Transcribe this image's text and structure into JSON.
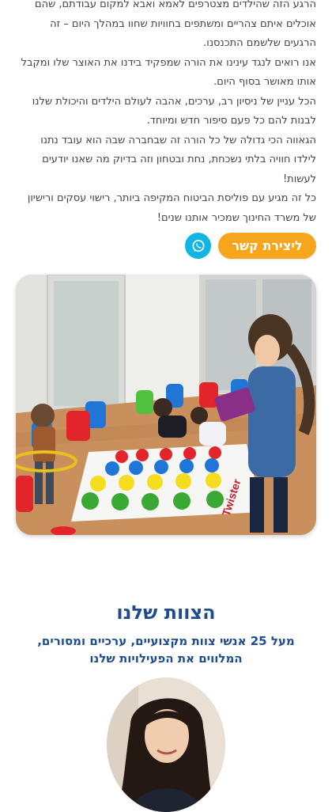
{
  "intro": {
    "paragraphs": [
      "הרגע הזה שהילדים מצטרפים לאמא ואבא למקום עבודתם, שהם אוכלים איתם צהריים ומשתפים בחוויות שחוו במהלך היום – זה הרגעים שלשמם התכנסנו.",
      "אנו רואים לנגד עינינו את הורה שמפקיד בידנו את האוצר שלו ומקבל אותו מאושר בסוף היום.",
      "הכל עניין של ניסיון רב, ערכים, אהבה לעולם הילדים והיכולת שלנו לבנות להם כל פעם סיפור חדש ומיוחד.",
      "הגאווה הכי גדולה של כל הורה זה שבחברה שבה הוא עובד נתנו לילדו חוויה בלתי נשכחת, נחת ובטחון וזה בדיוק מה שאנו יודעים לעשות!",
      "כל זה מגיע עם פוליסת הביטוח המקיפה ביותר, רישוי עסקים ורישיון של משרד החינוך שמכיר אותנו שנים!"
    ]
  },
  "cta": {
    "contact_label": "ליצירת קשר",
    "whatsapp_icon": "whatsapp-icon",
    "contact_color": "#f7a51c",
    "whatsapp_color": "#11b5e4"
  },
  "photo": {
    "mat_label": "Twister"
  },
  "team": {
    "title": "הצוות שלנו",
    "subtitle": "מעל 25 אנשי צוות מקצועיים, ערכיים ומסורים, המלווים את הפעילויות שלנו",
    "heading_color": "#1f4c8f"
  }
}
